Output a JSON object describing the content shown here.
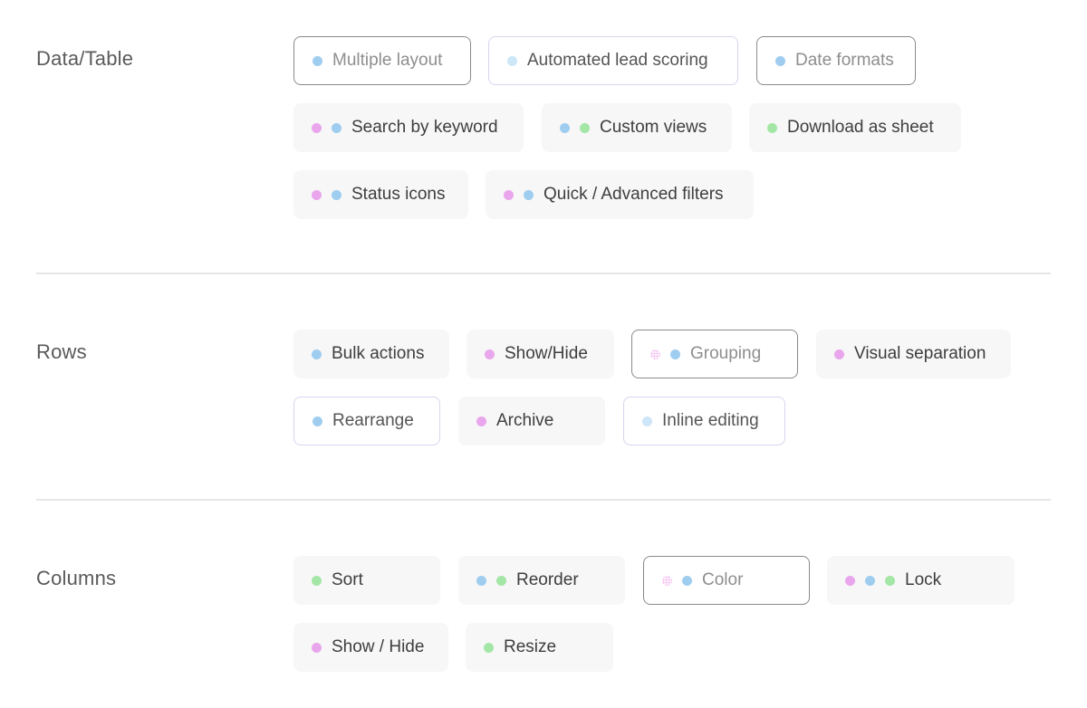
{
  "colors": {
    "pink": "#e9a6ec",
    "blue": "#9fcdf0",
    "lightblue": "#cde6f8",
    "green": "#a3e6a6",
    "dotted_pink": "#f0b7ef"
  },
  "sections": [
    {
      "title": "Data/Table",
      "chips": [
        {
          "label": "Multiple layout",
          "dots": [
            "blue"
          ],
          "style": "outlined"
        },
        {
          "label": "Automated lead scoring",
          "dots": [
            "lightblue"
          ],
          "style": "outlined-light"
        },
        {
          "label": "Date formats",
          "dots": [
            "blue"
          ],
          "style": "outlined"
        },
        {
          "label": "Search by keyword",
          "dots": [
            "pink",
            "blue"
          ],
          "style": "filled"
        },
        {
          "label": "Custom views",
          "dots": [
            "blue",
            "green"
          ],
          "style": "filled"
        },
        {
          "label": "Download as sheet",
          "dots": [
            "green"
          ],
          "style": "filled"
        },
        {
          "label": "Status icons",
          "dots": [
            "pink",
            "blue"
          ],
          "style": "filled"
        },
        {
          "label": "Quick / Advanced filters",
          "dots": [
            "pink",
            "blue"
          ],
          "style": "filled"
        }
      ]
    },
    {
      "title": "Rows",
      "chips": [
        {
          "label": "Bulk actions",
          "dots": [
            "blue"
          ],
          "style": "filled"
        },
        {
          "label": "Show/Hide",
          "dots": [
            "pink"
          ],
          "style": "filled"
        },
        {
          "label": "Grouping",
          "dots": [
            "dotted_pink",
            "blue"
          ],
          "style": "outlined"
        },
        {
          "label": "Visual separation",
          "dots": [
            "pink"
          ],
          "style": "filled"
        },
        {
          "label": "Rearrange",
          "dots": [
            "blue"
          ],
          "style": "outlined-light"
        },
        {
          "label": "Archive",
          "dots": [
            "pink"
          ],
          "style": "filled"
        },
        {
          "label": "Inline editing",
          "dots": [
            "lightblue"
          ],
          "style": "outlined-light"
        }
      ]
    },
    {
      "title": "Columns",
      "chips": [
        {
          "label": "Sort",
          "dots": [
            "green"
          ],
          "style": "filled"
        },
        {
          "label": "Reorder",
          "dots": [
            "blue",
            "green"
          ],
          "style": "filled"
        },
        {
          "label": "Color",
          "dots": [
            "dotted_pink",
            "blue"
          ],
          "style": "outlined"
        },
        {
          "label": "Lock",
          "dots": [
            "pink",
            "blue",
            "green"
          ],
          "style": "filled"
        },
        {
          "label": "Show / Hide",
          "dots": [
            "pink"
          ],
          "style": "filled"
        },
        {
          "label": "Resize",
          "dots": [
            "green"
          ],
          "style": "filled"
        }
      ]
    }
  ]
}
